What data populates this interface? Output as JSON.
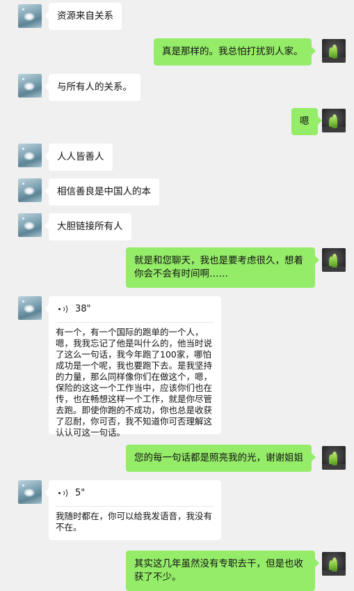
{
  "messages": [
    {
      "side": "in",
      "text": "资源来自关系"
    },
    {
      "side": "out",
      "text": "真是那样的。我总怕打扰到人家。"
    },
    {
      "side": "in",
      "text": "与所有人的关系。"
    },
    {
      "side": "out",
      "text": "嗯"
    },
    {
      "side": "in",
      "text": "人人皆善人"
    },
    {
      "side": "in",
      "text": "相信善良是中国人的本"
    },
    {
      "side": "in",
      "text": "大胆链接所有人"
    },
    {
      "side": "out",
      "text": "就是和您聊天，我也是要考虑很久，想着你会不会有时间啊……"
    },
    {
      "side": "in",
      "type": "voice",
      "duration": "38\"",
      "transcript": "有一个，有一个国际的跑单的一个人，嗯，我我忘记了他是叫什么的，他当时说了这么一句话，我今年跑了100家，哪怕成功是一个呢，我也要跑下去。是我坚持的力量，那么同样像你们在做这个，嗯，保险的这这一个工作当中，应该你们也在传，也在畅想这样一个工作，就是你尽管去跑。即使你跑的不成功，你也总是收获了忍耐，你可否，我不知道你可否理解这认认可这一句话。"
    },
    {
      "side": "out",
      "text": "您的每一句话都是照亮我的光，谢谢姐姐"
    },
    {
      "side": "in",
      "type": "voice",
      "duration": "5\"",
      "transcript": "我随时都在，你可以给我发语音，我没有不在。"
    },
    {
      "side": "out",
      "text": "其实这几年虽然没有专职去干，但是也收获了不少。"
    }
  ],
  "colors": {
    "background": "#f0f0f0",
    "incoming_bubble": "#ffffff",
    "outgoing_bubble": "#95ec69"
  },
  "icons": {
    "incoming_avatar": "lotus-avatar",
    "outgoing_avatar": "sprout-avatar",
    "voice": "voice-wave-icon"
  }
}
